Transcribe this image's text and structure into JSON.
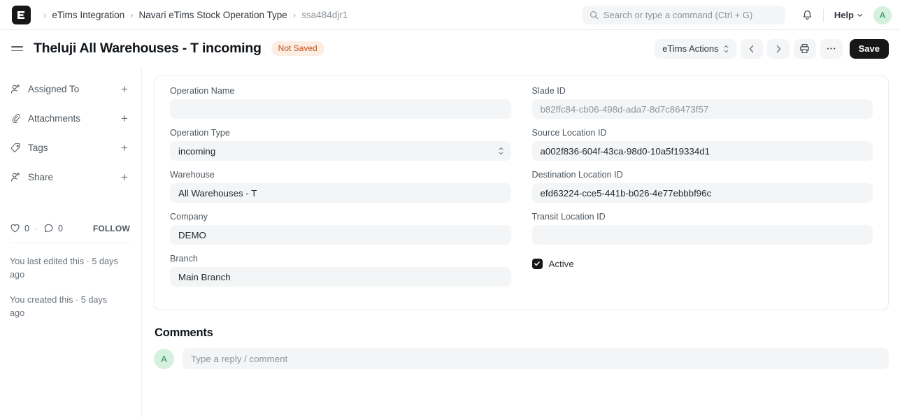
{
  "navbar": {
    "logo_letter": "E",
    "breadcrumb": [
      {
        "label": "eTims Integration",
        "current": false
      },
      {
        "label": "Navari eTims Stock Operation Type",
        "current": false
      },
      {
        "label": "ssa484djr1",
        "current": true
      }
    ],
    "search": {
      "placeholder": "Search or type a command (Ctrl + G)",
      "value": ""
    },
    "bell_icon": "bell-icon",
    "help_label": "Help",
    "avatar_initial": "A"
  },
  "pagehead": {
    "title": "Theluji All Warehouses - T incoming",
    "status_badge": "Not Saved",
    "status_badge_bg": "#fdeee3",
    "status_badge_color": "#c2521a",
    "actions_dropdown": "eTims Actions",
    "prev_label": "‹",
    "next_label": "›",
    "save_label": "Save"
  },
  "sidebar": {
    "items": [
      {
        "label": "Assigned To",
        "icon": "user-plus-icon",
        "add": "+"
      },
      {
        "label": "Attachments",
        "icon": "paperclip-icon",
        "add": "+"
      },
      {
        "label": "Tags",
        "icon": "tag-icon",
        "add": "+"
      },
      {
        "label": "Share",
        "icon": "user-plus-icon",
        "add": "+"
      }
    ],
    "like_count": "0",
    "separator_dot": "·",
    "comment_count": "0",
    "follow_label": "FOLLOW",
    "edited_meta": "You last edited this · 5 days ago",
    "created_meta": "You created this · 5 days ago"
  },
  "form": {
    "left_fields": [
      {
        "label": "Operation Name",
        "value": "",
        "type": "text",
        "muted": true
      },
      {
        "label": "Operation Type",
        "value": "incoming",
        "type": "select",
        "muted": false
      },
      {
        "label": "Warehouse",
        "value": "All Warehouses - T",
        "type": "text",
        "muted": false
      },
      {
        "label": "Company",
        "value": "DEMO",
        "type": "text",
        "muted": false
      },
      {
        "label": "Branch",
        "value": "Main Branch",
        "type": "text",
        "muted": false
      }
    ],
    "right_fields": [
      {
        "label": "Slade ID",
        "value": "b82ffc84-cb06-498d-ada7-8d7c86473f57",
        "type": "text",
        "muted": true
      },
      {
        "label": "Source Location ID",
        "value": "a002f836-604f-43ca-98d0-10a5f19334d1",
        "type": "text",
        "muted": false
      },
      {
        "label": "Destination Location ID",
        "value": "efd63224-cce5-441b-b026-4e77ebbbf96c",
        "type": "text",
        "muted": false
      },
      {
        "label": "Transit Location ID",
        "value": "",
        "type": "text",
        "muted": true
      }
    ],
    "checkbox": {
      "label": "Active",
      "checked": true
    }
  },
  "comments": {
    "heading": "Comments",
    "avatar_initial": "A",
    "placeholder": "Type a reply / comment",
    "value": ""
  }
}
